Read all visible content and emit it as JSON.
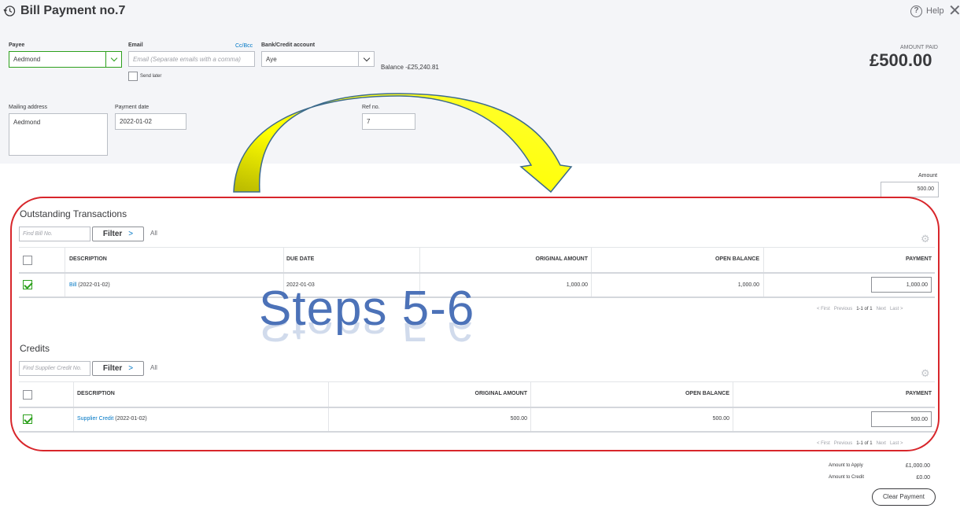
{
  "header": {
    "title": "Bill Payment no.7",
    "help_label": "Help"
  },
  "form": {
    "payee_label": "Payee",
    "payee_value": "Aedmond",
    "email_label": "Email",
    "email_placeholder": "Email (Separate emails with a comma)",
    "ccbcc_label": "Cc/Bcc",
    "send_later_label": "Send later",
    "bank_label": "Bank/Credit account",
    "bank_value": "Aye",
    "balance_text": "Balance -£25,240.81",
    "amount_paid_label": "AMOUNT PAID",
    "amount_paid_value": "£500.00",
    "mailing_label": "Mailing address",
    "mailing_value": "Aedmond",
    "payment_date_label": "Payment date",
    "payment_date_value": "2022-01-02",
    "ref_label": "Ref no.",
    "ref_value": "7"
  },
  "amount": {
    "label": "Amount",
    "value": "500.00"
  },
  "outstanding": {
    "title": "Outstanding Transactions",
    "find_placeholder": "Find Bill No.",
    "filter_label": "Filter",
    "all_label": "All",
    "columns": [
      "DESCRIPTION",
      "DUE DATE",
      "ORIGINAL AMOUNT",
      "OPEN BALANCE",
      "PAYMENT"
    ],
    "row": {
      "link": "Bill",
      "desc": "(2022-01-02)",
      "due": "2022-01-03",
      "original": "1,000.00",
      "open": "1,000.00",
      "payment": "1,000.00"
    },
    "pager": {
      "first": "< First",
      "previous": "Previous",
      "range": "1-1 of 1",
      "next": "Next",
      "last": "Last >"
    }
  },
  "credits": {
    "title": "Credits",
    "find_placeholder": "Find Supplier Credit No.",
    "filter_label": "Filter",
    "all_label": "All",
    "columns": [
      "DESCRIPTION",
      "ORIGINAL AMOUNT",
      "OPEN BALANCE",
      "PAYMENT"
    ],
    "row": {
      "link": "Supplier Credit",
      "desc": "(2022-01-02)",
      "original": "500.00",
      "open": "500.00",
      "payment": "500.00"
    },
    "pager": {
      "first": "< First",
      "previous": "Previous",
      "range": "1-1 of 1",
      "next": "Next",
      "last": "Last >"
    }
  },
  "summary": {
    "apply_label": "Amount to Apply",
    "apply_value": "£1,000.00",
    "credit_label": "Amount to Credit",
    "credit_value": "£0.00",
    "clear_label": "Clear Payment"
  },
  "annotation": {
    "text": "Steps 5-6"
  },
  "colors": {
    "accent_green": "#2ca01c",
    "link_blue": "#0077c5",
    "ring_red": "#d8262b",
    "arrow_yellow": "#ffff00",
    "annotation_blue": "#4c72b8"
  }
}
